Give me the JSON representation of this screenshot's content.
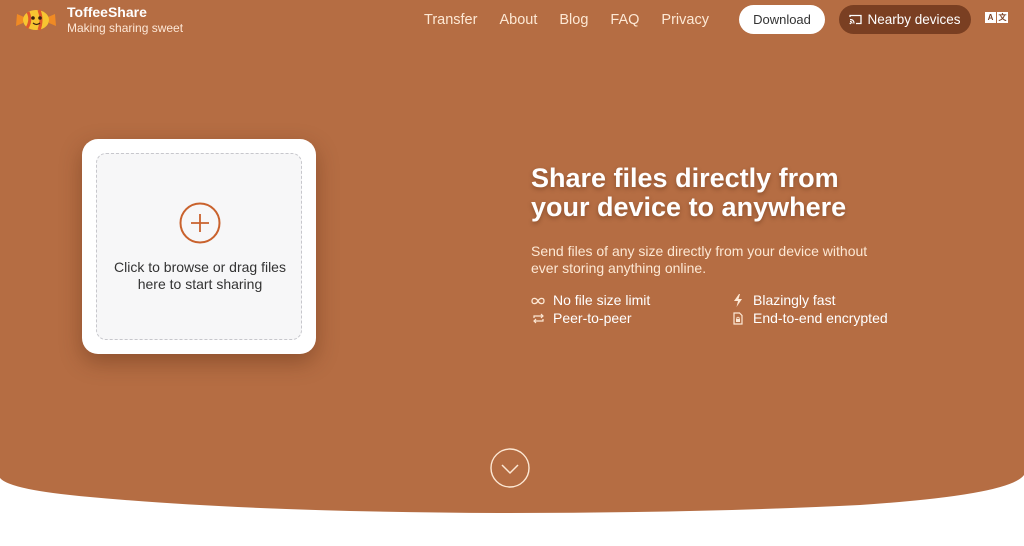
{
  "brand": {
    "name": "ToffeeShare",
    "tagline": "Making sharing sweet",
    "logo_icon": "candy-logo-icon"
  },
  "nav": {
    "items": [
      {
        "label": "Transfer"
      },
      {
        "label": "About"
      },
      {
        "label": "Blog"
      },
      {
        "label": "FAQ"
      },
      {
        "label": "Privacy"
      }
    ],
    "download_label": "Download",
    "nearby_label": "Nearby devices",
    "nearby_icon": "cast-icon",
    "language_icon": "translate-icon",
    "language_glyphs": [
      "A",
      "文"
    ]
  },
  "upload": {
    "icon": "plus-circle-icon",
    "text_line1": "Click to browse or drag files",
    "text_line2": "here to start sharing"
  },
  "hero": {
    "headline_line1": "Share files directly from",
    "headline_line2": "your device to anywhere",
    "subtext_line1": "Send files of any size directly from your device without",
    "subtext_line2": "ever storing anything online.",
    "features": [
      {
        "icon": "infinity-icon",
        "label": "No file size limit"
      },
      {
        "icon": "bolt-icon",
        "label": "Blazingly fast"
      },
      {
        "icon": "swap-arrows-icon",
        "label": "Peer-to-peer"
      },
      {
        "icon": "lock-file-icon",
        "label": "End-to-end encrypted"
      }
    ],
    "scroll_icon": "chevron-down-circle-icon"
  },
  "colors": {
    "brand_brown": "#b56d43",
    "dark_brown": "#7a3f22",
    "accent_orange": "#c9622d",
    "cream": "#fde8d4"
  }
}
